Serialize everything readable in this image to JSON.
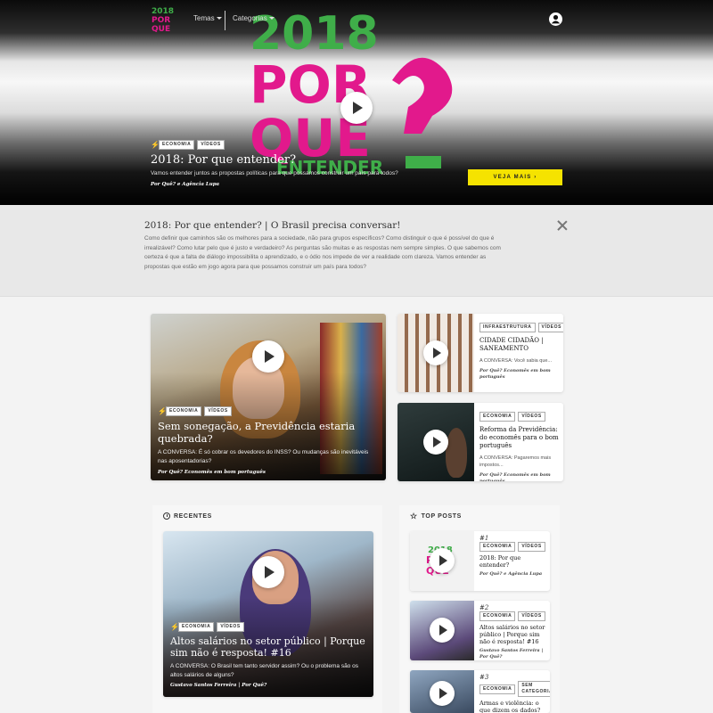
{
  "nav": {
    "temas_label": "Temas",
    "categorias_label": "Categorias",
    "logo_lines": [
      "2018",
      "POR",
      "QUE"
    ]
  },
  "hero": {
    "art_lines": [
      "2018",
      "POR",
      "QUE",
      "ENTENDER"
    ],
    "tags": [
      "ECONOMIA",
      "VÍDEOS"
    ],
    "title": "2018: Por que entender?",
    "description": "Vamos entender juntos as propostas políticas para que possamos construir um país para todos?",
    "author": "Por Quê? e Agência Lupa",
    "cta_label": "VEJA MAIS ›"
  },
  "info": {
    "title": "2018: Por que entender? | O Brasil precisa conversar!",
    "text": "Como definir que caminhos são os melhores para a sociedade, não para grupos específicos? Como distinguir o que é possível do que é irrealizável? Como lutar pelo que é justo e verdadeiro? As perguntas são muitas e as respostas nem sempre simples. O que sabemos com certeza é que a falta de diálogo impossibilita o aprendizado, e o ódio nos impede de ver a realidade com clareza. Vamos entender as propostas que estão em jogo agora para que possamos construir um país para todos?"
  },
  "featured": {
    "main": {
      "tags": [
        "ECONOMIA",
        "VÍDEOS"
      ],
      "title": "Sem sonegação, a Previdência estaria quebrada?",
      "description": "A CONVERSA: É só cobrar os devedores do INSS? Ou mudanças são inevitáveis nas aposentadorias?",
      "author": "Por Quê? Economês em bom português"
    },
    "side": [
      {
        "tags": [
          "INFRAESTRUTURA",
          "VÍDEOS"
        ],
        "title": "CIDADE CIDADÃO | SANEAMENTO",
        "description": "A CONVERSA: Você sabia que...",
        "author": "Por Quê? Economês em bom português"
      },
      {
        "tags": [
          "ECONOMIA",
          "VÍDEOS"
        ],
        "title": "Reforma da Previdência: do economês para o bom português",
        "description": "A CONVERSA: Pagaremos mais impostos...",
        "author": "Por Quê? Economês em bom português"
      }
    ]
  },
  "recentes": {
    "heading": "RECENTES",
    "card": {
      "tags": [
        "ECONOMIA",
        "VÍDEOS"
      ],
      "title": "Altos salários no setor público | Porque sim não é resposta! #16",
      "description": "A CONVERSA: O Brasil tem tanto servidor assim? Ou o problema são os altos salários de alguns?",
      "author": "Gustavo Santos Ferreira | Por Quê?"
    }
  },
  "top_posts": {
    "heading": "TOP POSTS",
    "items": [
      {
        "rank": "#1",
        "tags": [
          "ECONOMIA",
          "VÍDEOS"
        ],
        "title": "2018: Por que entender?",
        "author": "Por Quê? e Agência Lupa"
      },
      {
        "rank": "#2",
        "tags": [
          "ECONOMIA",
          "VÍDEOS"
        ],
        "title": "Altos salários no setor público | Porque sim não é resposta! #16",
        "author": "Gustavo Santos Ferreira | Por Quê?"
      },
      {
        "rank": "#3",
        "tags": [
          "ECONOMIA",
          "SEM CATEGORIA"
        ],
        "title": "Armas e violência: o que dizem os dados?",
        "author": ""
      }
    ]
  },
  "colors": {
    "brand_green": "#3fae49",
    "brand_pink": "#e2198c",
    "cta_yellow": "#f5e300",
    "bolt_yellow": "#f4d000"
  }
}
